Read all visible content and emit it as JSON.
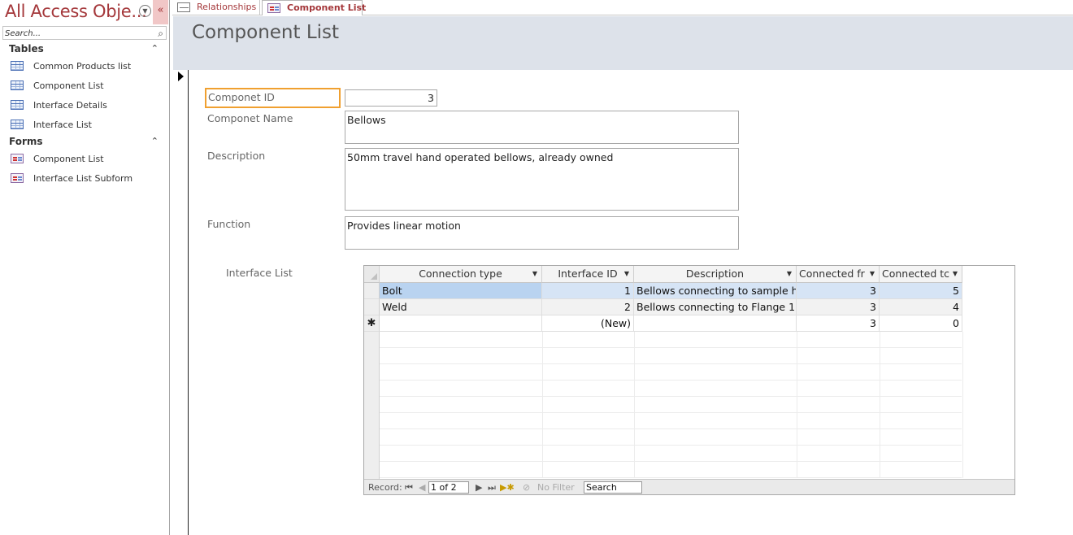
{
  "nav_pane": {
    "title": "All Access Obje...",
    "shutter_glyph": "«",
    "search_placeholder": "Search...",
    "groups": [
      {
        "label": "Tables",
        "items": [
          "Common Products list",
          "Component List",
          "Interface Details",
          "Interface List"
        ]
      },
      {
        "label": "Forms",
        "items": [
          "Component List",
          "Interface List Subform"
        ]
      }
    ]
  },
  "tabs": [
    {
      "label": "Relationships",
      "icon": "relationships-icon"
    },
    {
      "label": "Component List",
      "icon": "form-icon",
      "active": true
    }
  ],
  "form": {
    "title": "Component List",
    "fields": {
      "component_id_label": "Componet ID",
      "component_id_value": "3",
      "component_name_label": "Componet Name",
      "component_name_value": "Bellows",
      "description_label": "Description",
      "description_value": "50mm travel hand operated bellows, already owned",
      "function_label": "Function",
      "function_value": "Provides linear motion"
    },
    "subform_label": "Interface List"
  },
  "datasheet": {
    "columns": [
      "Connection type",
      "Interface ID",
      "Description",
      "Connected fr",
      "Connected tc"
    ],
    "rows": [
      {
        "connection_type": "Bolt",
        "interface_id": "1",
        "description": "Bellows connecting to sample h",
        "connected_from": "3",
        "connected_to": "5"
      },
      {
        "connection_type": "Weld",
        "interface_id": "2",
        "description": "Bellows connecting to Flange 1",
        "connected_from": "3",
        "connected_to": "4"
      },
      {
        "connection_type": "",
        "interface_id": "(New)",
        "description": "",
        "connected_from": "3",
        "connected_to": "0"
      }
    ],
    "new_row_marker": "✱",
    "record_nav": {
      "label": "Record:",
      "current": "1 of 2",
      "filter": "No Filter",
      "search": "Search"
    }
  }
}
